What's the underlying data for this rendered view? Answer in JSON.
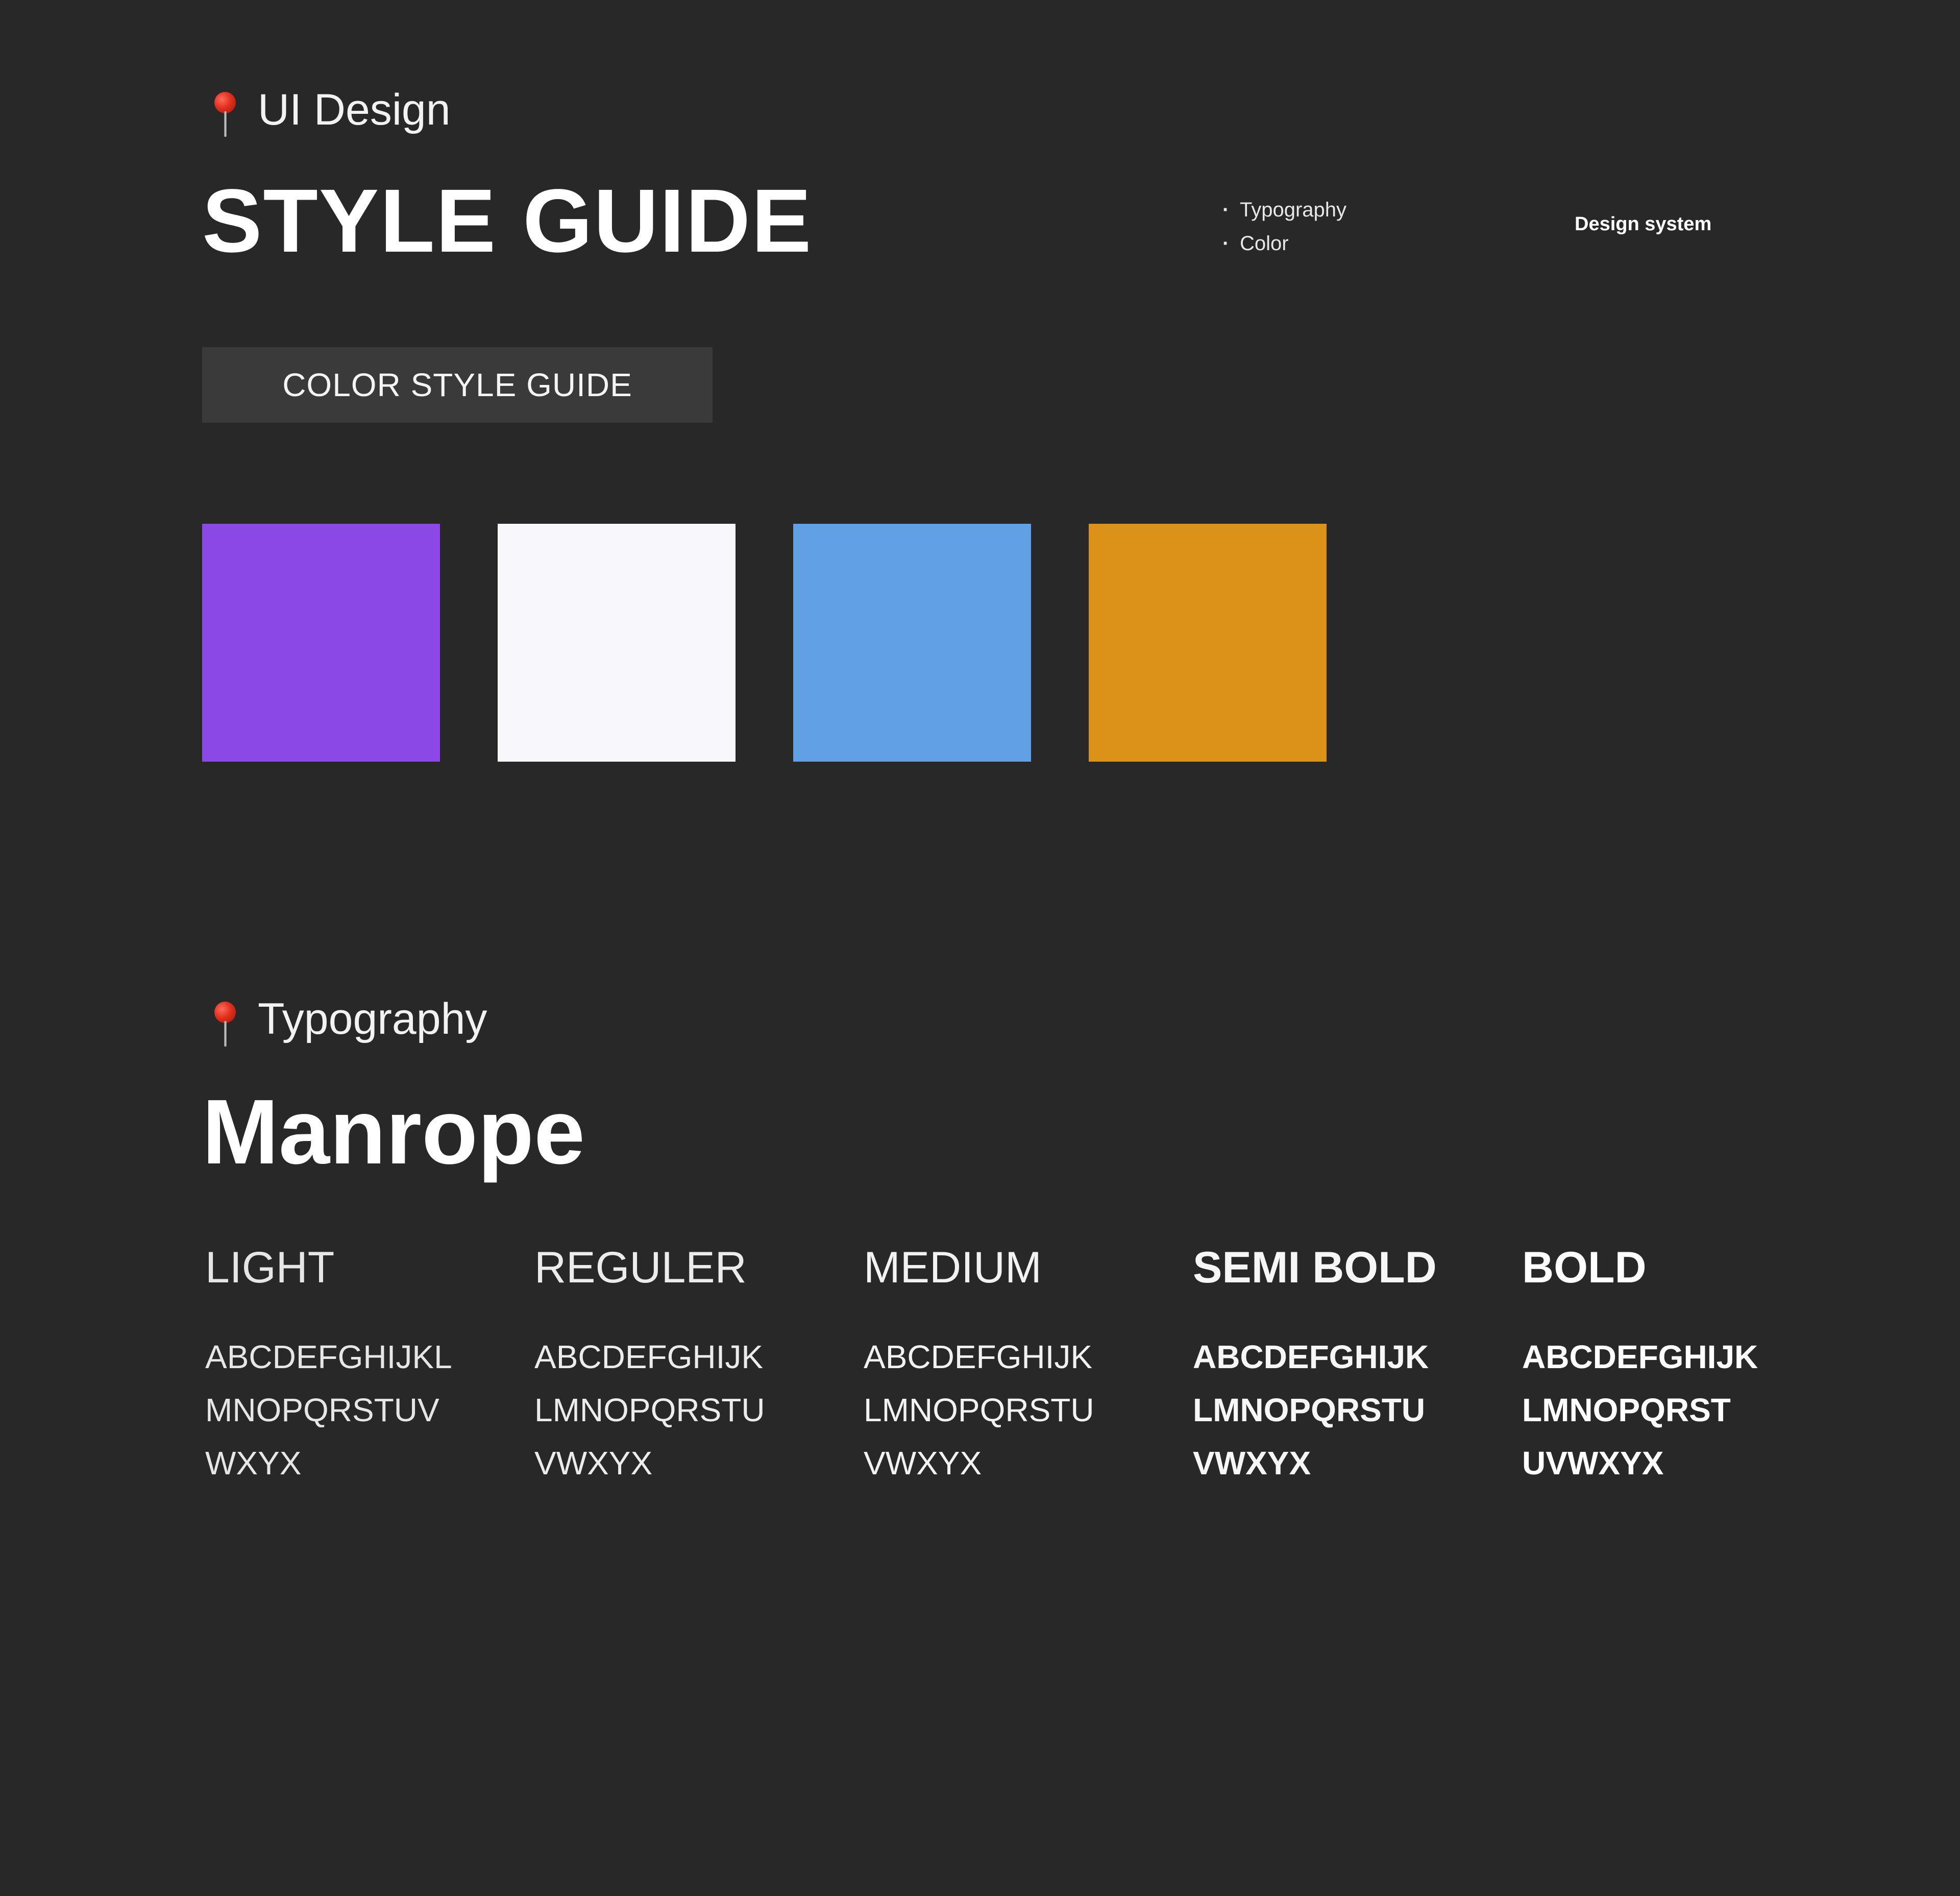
{
  "header": {
    "section_label": "UI Design",
    "title": "STYLE GUIDE",
    "toc": [
      "Typography",
      "Color"
    ],
    "right_label": "Design system"
  },
  "color_section": {
    "tag_label": "COLOR STYLE GUIDE",
    "swatches": [
      {
        "color": "#8B48E6"
      },
      {
        "color": "#F8F8FC"
      },
      {
        "color": "#62A0E6"
      },
      {
        "color": "#DC9118"
      }
    ]
  },
  "typography": {
    "section_label": "Typography",
    "font_name": "Manrope",
    "weights": [
      {
        "label": "LIGHT",
        "lines": [
          "ABCDEFGHIJKL",
          "MNOPQRSTUV",
          "WXYX"
        ]
      },
      {
        "label": "REGULER",
        "lines": [
          "ABCDEFGHIJK",
          "LMNOPQRSTU",
          "VWXYX"
        ]
      },
      {
        "label": "MEDIUM",
        "lines": [
          "ABCDEFGHIJK",
          "LMNOPQRSTU",
          "VWXYX"
        ]
      },
      {
        "label": "SEMI BOLD",
        "lines": [
          "ABCDEFGHIJK",
          "LMNOPQRSTU",
          "VWXYX"
        ]
      },
      {
        "label": "BOLD",
        "lines": [
          "ABCDEFGHIJK",
          "LMNOPQRST",
          "UVWXYX"
        ]
      }
    ]
  },
  "icons": {
    "section_marker": "pushpin-icon"
  }
}
